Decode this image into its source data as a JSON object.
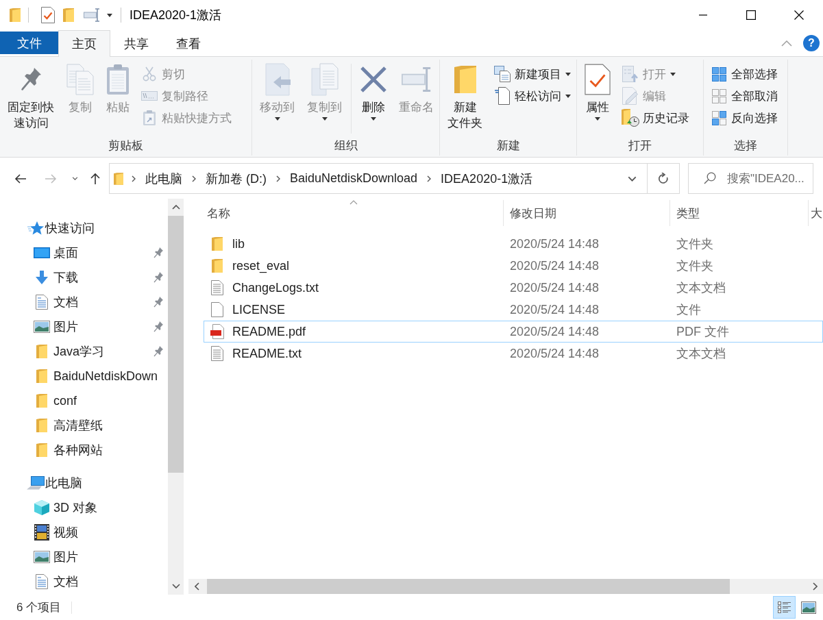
{
  "title_bar": {
    "title": "IDEA2020-1激活"
  },
  "ribbon": {
    "tabs": [
      {
        "label": "文件",
        "kind": "file",
        "selected": false
      },
      {
        "label": "主页",
        "kind": "tab",
        "selected": true
      },
      {
        "label": "共享",
        "kind": "tab",
        "selected": false
      },
      {
        "label": "查看",
        "kind": "tab",
        "selected": false
      }
    ],
    "help": "?",
    "groups": [
      {
        "label": "剪贴板",
        "commands": [
          {
            "label": "固定到快速访问",
            "kind": "large",
            "disabled": false,
            "dropdown": false
          },
          {
            "label": "复制",
            "kind": "large",
            "disabled": true,
            "dropdown": false
          },
          {
            "label": "粘贴",
            "kind": "large",
            "disabled": true,
            "dropdown": false
          },
          {
            "label": "剪切",
            "kind": "small",
            "disabled": true,
            "dropdown": false
          },
          {
            "label": "复制路径",
            "kind": "small",
            "disabled": true,
            "dropdown": false
          },
          {
            "label": "粘贴快捷方式",
            "kind": "small",
            "disabled": true,
            "dropdown": false
          }
        ]
      },
      {
        "label": "组织",
        "commands": [
          {
            "label": "移动到",
            "kind": "large",
            "disabled": true,
            "dropdown": true
          },
          {
            "label": "复制到",
            "kind": "large",
            "disabled": true,
            "dropdown": true
          },
          {
            "label": "删除",
            "kind": "large",
            "disabled": false,
            "dropdown": true
          },
          {
            "label": "重命名",
            "kind": "large",
            "disabled": true,
            "dropdown": false
          }
        ]
      },
      {
        "label": "新建",
        "commands": [
          {
            "label": "新建文件夹",
            "kind": "large",
            "disabled": false,
            "dropdown": false
          },
          {
            "label": "新建项目",
            "kind": "small",
            "disabled": false,
            "dropdown": true
          },
          {
            "label": "轻松访问",
            "kind": "small",
            "disabled": false,
            "dropdown": true
          }
        ]
      },
      {
        "label": "打开",
        "commands": [
          {
            "label": "属性",
            "kind": "large",
            "disabled": false,
            "dropdown": true
          },
          {
            "label": "打开",
            "kind": "small",
            "disabled": true,
            "dropdown": true
          },
          {
            "label": "编辑",
            "kind": "small",
            "disabled": true,
            "dropdown": false
          },
          {
            "label": "历史记录",
            "kind": "small",
            "disabled": false,
            "dropdown": false
          }
        ]
      },
      {
        "label": "选择",
        "commands": [
          {
            "label": "全部选择",
            "kind": "small",
            "disabled": false,
            "dropdown": false
          },
          {
            "label": "全部取消",
            "kind": "small",
            "disabled": false,
            "dropdown": false
          },
          {
            "label": "反向选择",
            "kind": "small",
            "disabled": false,
            "dropdown": false
          }
        ]
      }
    ]
  },
  "address_bar": {
    "back": {
      "disabled": false
    },
    "forward": {
      "disabled": true
    },
    "path": [
      "此电脑",
      "新加卷 (D:)",
      "BaiduNetdiskDownload",
      "IDEA2020-1激活"
    ],
    "search": {
      "placeholder": "搜索\"IDEA20..."
    }
  },
  "navigation_pane": {
    "items": [
      {
        "label": "快速访问",
        "kind": "quickaccess",
        "children": [
          {
            "label": "桌面",
            "kind": "desktop",
            "pinned": true
          },
          {
            "label": "下载",
            "kind": "downloads",
            "pinned": true
          },
          {
            "label": "文档",
            "kind": "documents",
            "pinned": true
          },
          {
            "label": "图片",
            "kind": "pictures",
            "pinned": true
          },
          {
            "label": "Java学习",
            "kind": "folder",
            "pinned": true
          },
          {
            "label": "BaiduNetdiskDown",
            "kind": "folder",
            "pinned": false
          },
          {
            "label": "conf",
            "kind": "folder",
            "pinned": false
          },
          {
            "label": "高清壁纸",
            "kind": "folder",
            "pinned": false
          },
          {
            "label": "各种网站",
            "kind": "folder",
            "pinned": false
          }
        ]
      },
      {
        "label": "此电脑",
        "kind": "computer",
        "children": [
          {
            "label": "3D 对象",
            "kind": "objects",
            "pinned": false
          },
          {
            "label": "视频",
            "kind": "videos",
            "pinned": false
          },
          {
            "label": "图片",
            "kind": "pictures",
            "pinned": false
          },
          {
            "label": "文档",
            "kind": "documents",
            "pinned": false
          }
        ]
      }
    ]
  },
  "file_list": {
    "columns": [
      {
        "label": "名称",
        "sorted": true
      },
      {
        "label": "修改日期",
        "sorted": false
      },
      {
        "label": "类型",
        "sorted": false
      },
      {
        "label": "大",
        "sorted": false
      }
    ],
    "rows": [
      {
        "name": "lib",
        "kind": "folder",
        "modified": "2020/5/24 14:48",
        "type": "文件夹",
        "focused": false
      },
      {
        "name": "reset_eval",
        "kind": "folder",
        "modified": "2020/5/24 14:48",
        "type": "文件夹",
        "focused": false
      },
      {
        "name": "ChangeLogs.txt",
        "kind": "text",
        "modified": "2020/5/24 14:48",
        "type": "文本文档",
        "focused": false
      },
      {
        "name": "LICENSE",
        "kind": "file",
        "modified": "2020/5/24 14:48",
        "type": "文件",
        "focused": false
      },
      {
        "name": "README.pdf",
        "kind": "pdf",
        "modified": "2020/5/24 14:48",
        "type": "PDF 文件",
        "focused": true
      },
      {
        "name": "README.txt",
        "kind": "text",
        "modified": "2020/5/24 14:48",
        "type": "文本文档",
        "focused": false
      }
    ]
  },
  "status_bar": {
    "item_count": "6 个项目",
    "views": [
      {
        "kind": "details",
        "selected": true
      },
      {
        "kind": "largeicons",
        "selected": false
      }
    ]
  }
}
